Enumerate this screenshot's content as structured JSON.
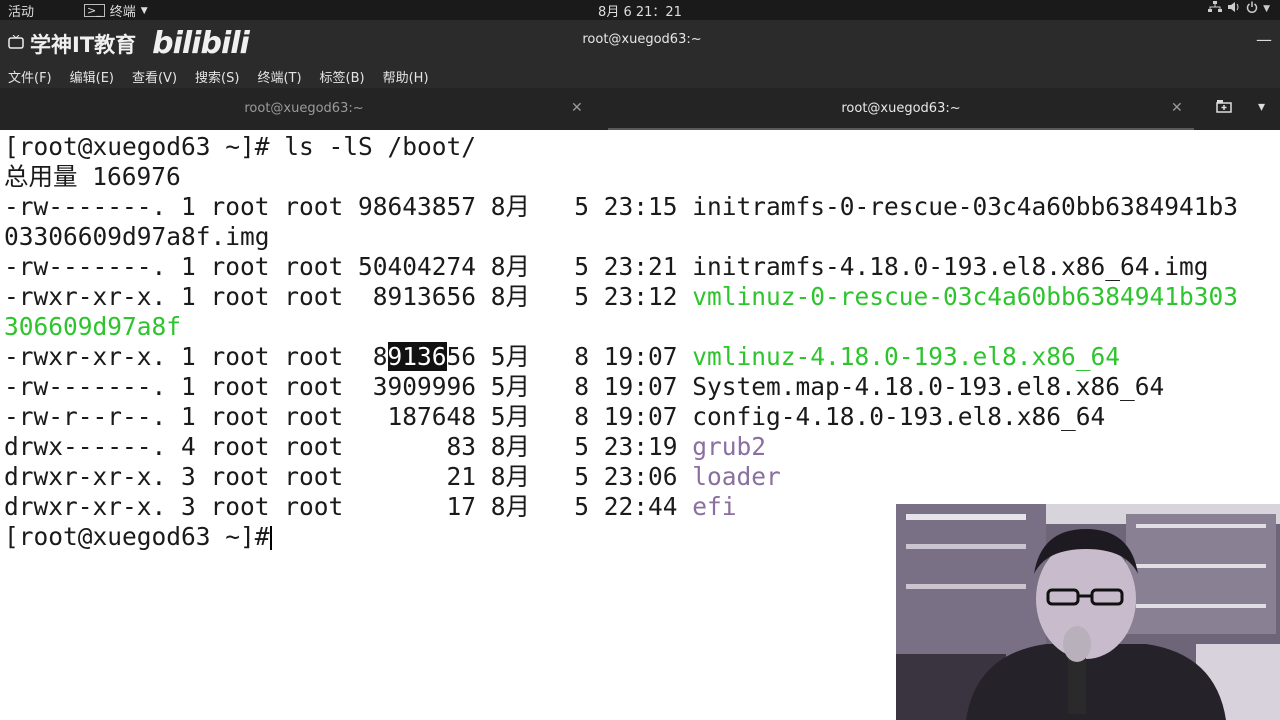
{
  "topbar": {
    "activities": "活动",
    "terminal_menu": "终端",
    "clock": "8月 6  21：21"
  },
  "window": {
    "watermark_text": "学神IT教育",
    "watermark_logo": "bilibili",
    "title": "root@xuegod63:~"
  },
  "menubar": {
    "items": [
      "文件(F)",
      "编辑(E)",
      "查看(V)",
      "搜索(S)",
      "终端(T)",
      "标签(B)",
      "帮助(H)"
    ]
  },
  "tabs": [
    {
      "label": "root@xuegod63:~",
      "active": false
    },
    {
      "label": "root@xuegod63:~",
      "active": true
    }
  ],
  "terminal": {
    "prompt": "[root@xuegod63 ~]#",
    "command": " ls -lS /boot/",
    "total": "总用量 166976",
    "rows": [
      {
        "prefix": "-rw-------. 1 root root 98643857 8月   5 23:15 ",
        "name": "initramfs-0-rescue-03c4a60bb6384941b3",
        "cont": "03306609d97a8f.img",
        "color": "normal"
      },
      {
        "prefix": "-rw-------. 1 root root 50404274 8月   5 23:21 ",
        "name": "initramfs-4.18.0-193.el8.x86_64.img",
        "color": "normal"
      },
      {
        "prefix": "-rwxr-xr-x. 1 root root  8913656 8月   5 23:12 ",
        "name": "vmlinuz-0-rescue-03c4a60bb6384941b303",
        "cont": "306609d97a8f",
        "color": "green"
      },
      {
        "prefix_a": "-rwxr-xr-x. 1 root root  8",
        "selected": "9136",
        "prefix_b": "56 5月   8 19:07 ",
        "name": "vmlinuz-4.18.0-193.el8.x86_64",
        "color": "green"
      },
      {
        "prefix": "-rw-------. 1 root root  3909996 5月   8 19:07 ",
        "name": "System.map-4.18.0-193.el8.x86_64",
        "color": "normal"
      },
      {
        "prefix": "-rw-r--r--. 1 root root   187648 5月   8 19:07 ",
        "name": "config-4.18.0-193.el8.x86_64",
        "color": "normal"
      },
      {
        "prefix": "drwx------. 4 root root       83 8月   5 23:19 ",
        "name": "grub2",
        "color": "purple"
      },
      {
        "prefix": "drwxr-xr-x. 3 root root       21 8月   5 23:06 ",
        "name": "loader",
        "color": "purple"
      },
      {
        "prefix": "drwxr-xr-x. 3 root root       17 8月   5 22:44 ",
        "name": "efi",
        "color": "purple"
      }
    ]
  },
  "colors": {
    "exec_green": "#2ec42e",
    "dir_purple": "#8a6fa0",
    "chrome_bg": "#2b2b2b"
  }
}
